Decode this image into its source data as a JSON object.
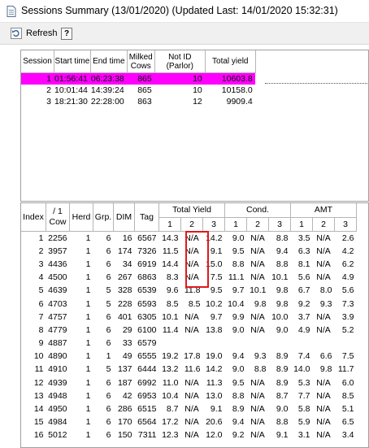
{
  "window": {
    "title": "Sessions Summary (13/01/2020) (Updated Last: 14/01/2020 15:32:31)",
    "icon": "document-icon"
  },
  "toolbar": {
    "refresh_label": "Refresh",
    "refresh_icon": "refresh-icon",
    "help_icon": "help-icon",
    "help_glyph": "?"
  },
  "sessions": {
    "headers": {
      "session": "Session",
      "start": "Start time",
      "end": "End time",
      "milked": "Milked Cows",
      "notid": "Not ID (Parlor)",
      "total": "Total yield"
    },
    "rows": [
      {
        "session": "1",
        "start": "01:56:41",
        "end": "06:23:38",
        "milked": "865",
        "notid": "10",
        "total": "10603.8",
        "selected": true
      },
      {
        "session": "2",
        "start": "10:01:44",
        "end": "14:39:24",
        "milked": "865",
        "notid": "10",
        "total": "10158.0",
        "selected": false
      },
      {
        "session": "3",
        "start": "18:21:30",
        "end": "22:28:00",
        "milked": "863",
        "notid": "12",
        "total": "9909.4",
        "selected": false
      }
    ]
  },
  "cows": {
    "headers": {
      "index": "Index",
      "cow_top": "/ 1",
      "cow": "Cow",
      "herd": "Herd",
      "grp": "Grp.",
      "dim": "DIM",
      "tag": "Tag",
      "total_yield": "Total Yield",
      "cond": "Cond.",
      "amt": "AMT",
      "sub": [
        "1",
        "2",
        "3",
        "1",
        "2",
        "3",
        "1",
        "2",
        "3"
      ]
    },
    "rows": [
      [
        "1",
        "2256",
        "1",
        "6",
        "16",
        "6567",
        "14.3",
        "N/A",
        "14.2",
        "9.0",
        "N/A",
        "8.8",
        "3.5",
        "N/A",
        "2.6"
      ],
      [
        "2",
        "3957",
        "1",
        "6",
        "174",
        "7326",
        "11.5",
        "N/A",
        "9.1",
        "9.5",
        "N/A",
        "9.4",
        "6.3",
        "N/A",
        "4.2"
      ],
      [
        "3",
        "4436",
        "1",
        "6",
        "34",
        "6919",
        "14.4",
        "N/A",
        "15.0",
        "8.8",
        "N/A",
        "8.8",
        "8.1",
        "N/A",
        "6.2"
      ],
      [
        "4",
        "4500",
        "1",
        "6",
        "267",
        "6863",
        "8.3",
        "N/A",
        "7.5",
        "11.1",
        "N/A",
        "10.1",
        "5.6",
        "N/A",
        "4.9"
      ],
      [
        "5",
        "4639",
        "1",
        "5",
        "328",
        "6539",
        "9.6",
        "11.8",
        "9.5",
        "9.7",
        "10.1",
        "9.8",
        "6.7",
        "8.0",
        "5.6"
      ],
      [
        "6",
        "4703",
        "1",
        "5",
        "228",
        "6593",
        "8.5",
        "8.5",
        "10.2",
        "10.4",
        "9.8",
        "9.8",
        "9.2",
        "9.3",
        "7.3"
      ],
      [
        "7",
        "4757",
        "1",
        "6",
        "401",
        "6305",
        "10.1",
        "N/A",
        "9.7",
        "9.9",
        "N/A",
        "10.0",
        "3.7",
        "N/A",
        "3.9"
      ],
      [
        "8",
        "4779",
        "1",
        "6",
        "29",
        "6100",
        "11.4",
        "N/A",
        "13.8",
        "9.0",
        "N/A",
        "9.0",
        "4.9",
        "N/A",
        "5.2"
      ],
      [
        "9",
        "4887",
        "1",
        "6",
        "33",
        "6579",
        "",
        "",
        "",
        "",
        "",
        "",
        "",
        "",
        ""
      ],
      [
        "10",
        "4890",
        "1",
        "1",
        "49",
        "6555",
        "19.2",
        "17.8",
        "19.0",
        "9.4",
        "9.3",
        "8.9",
        "7.4",
        "6.6",
        "7.5"
      ],
      [
        "11",
        "4910",
        "1",
        "5",
        "137",
        "6444",
        "13.2",
        "11.6",
        "14.2",
        "9.0",
        "8.8",
        "8.9",
        "14.0",
        "9.8",
        "11.7"
      ],
      [
        "12",
        "4939",
        "1",
        "6",
        "187",
        "6992",
        "11.0",
        "N/A",
        "11.3",
        "9.5",
        "N/A",
        "8.9",
        "5.3",
        "N/A",
        "6.0"
      ],
      [
        "13",
        "4948",
        "1",
        "6",
        "42",
        "6953",
        "10.4",
        "N/A",
        "13.0",
        "8.8",
        "N/A",
        "8.7",
        "7.7",
        "N/A",
        "8.5"
      ],
      [
        "14",
        "4950",
        "1",
        "6",
        "286",
        "6515",
        "8.7",
        "N/A",
        "9.1",
        "8.9",
        "N/A",
        "9.0",
        "5.8",
        "N/A",
        "5.1"
      ],
      [
        "15",
        "4984",
        "1",
        "6",
        "170",
        "6564",
        "17.2",
        "N/A",
        "20.6",
        "9.4",
        "N/A",
        "8.8",
        "5.9",
        "N/A",
        "6.5"
      ],
      [
        "16",
        "5012",
        "1",
        "6",
        "150",
        "7311",
        "12.3",
        "N/A",
        "12.0",
        "9.2",
        "N/A",
        "9.1",
        "3.1",
        "N/A",
        "3.4"
      ]
    ]
  },
  "colors": {
    "selected_row": "#ff00ff",
    "highlight_box": "#e0191b"
  }
}
